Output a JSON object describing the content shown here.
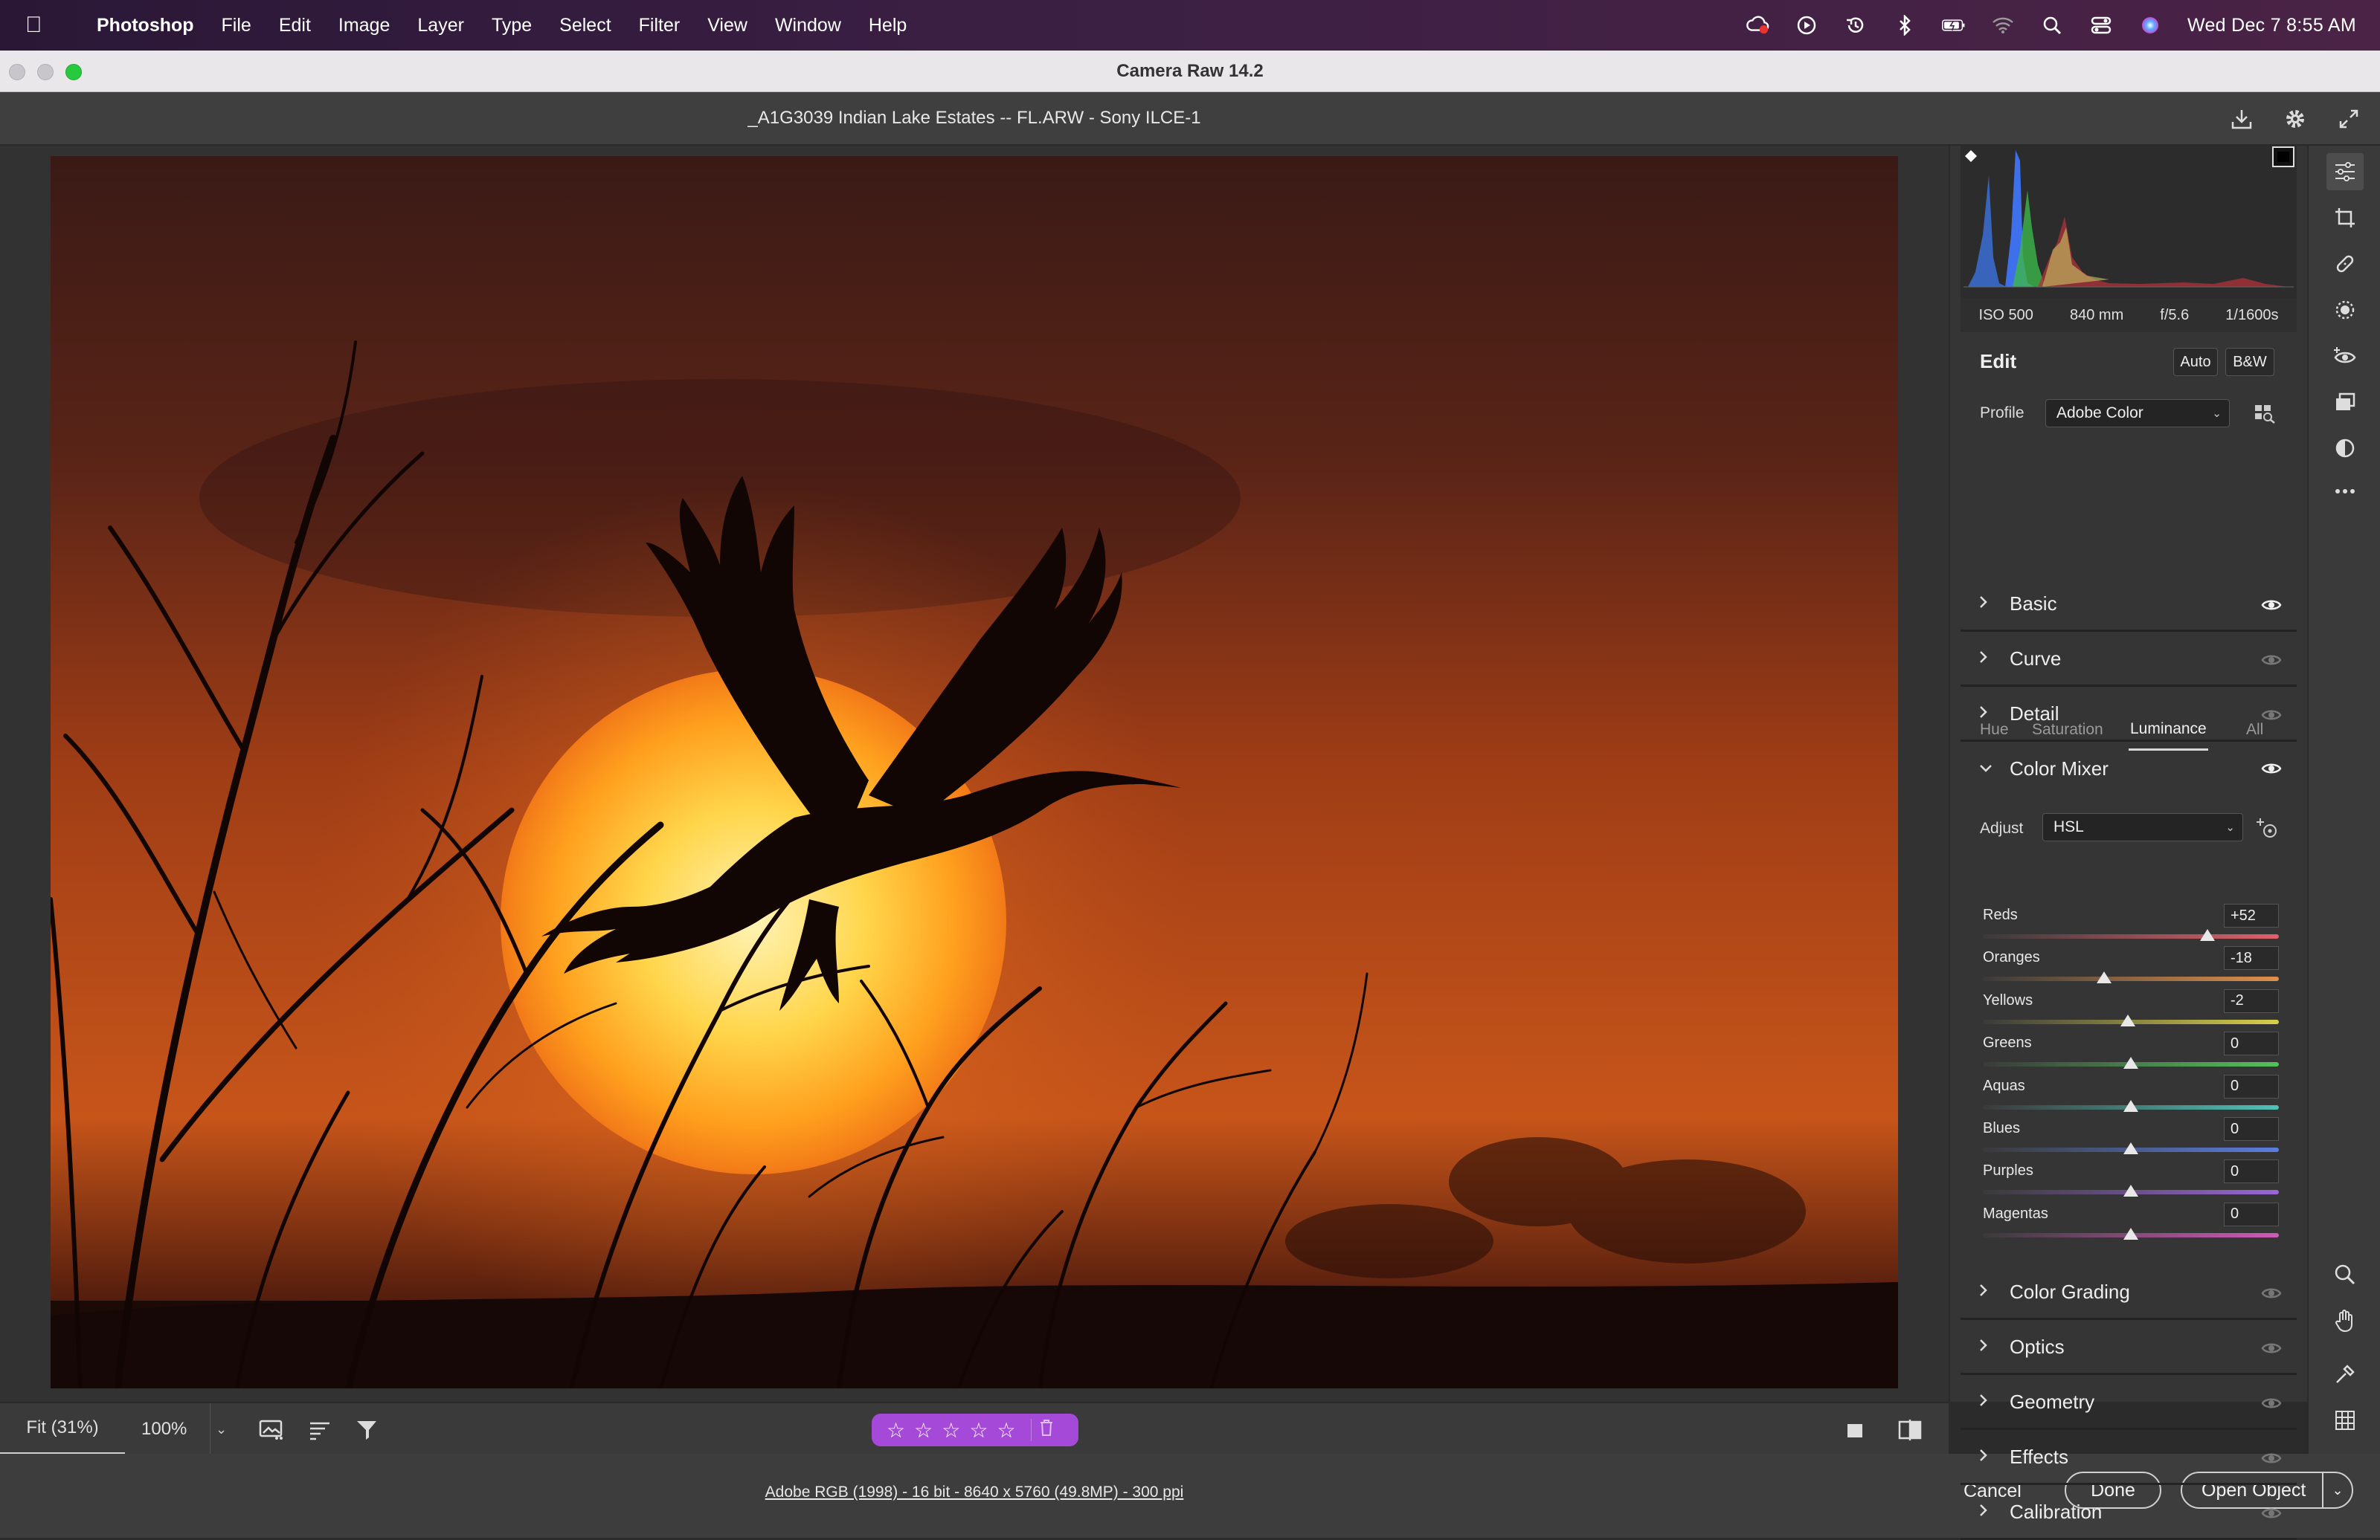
{
  "menubar": {
    "app": "Photoshop",
    "items": [
      "File",
      "Edit",
      "Image",
      "Layer",
      "Type",
      "Select",
      "Filter",
      "View",
      "Window",
      "Help"
    ],
    "clock": "Wed Dec 7  8:55 AM"
  },
  "window": {
    "title": "Camera Raw 14.2"
  },
  "toolbar": {
    "filename": "_A1G3039 Indian Lake Estates -- FL.ARW  -  Sony ILCE-1"
  },
  "histogram": {
    "exif": {
      "iso": "ISO 500",
      "focal": "840 mm",
      "aperture": "f/5.6",
      "shutter": "1/1600s"
    }
  },
  "edit": {
    "title": "Edit",
    "auto_label": "Auto",
    "bw_label": "B&W",
    "profile_label": "Profile",
    "profile_value": "Adobe Color"
  },
  "sections_top": [
    {
      "name": "Basic",
      "eye_active": true
    },
    {
      "name": "Curve",
      "eye_active": false
    },
    {
      "name": "Detail",
      "eye_active": false
    }
  ],
  "color_mixer": {
    "name": "Color Mixer",
    "adjust_label": "Adjust",
    "adjust_value": "HSL",
    "tabs": [
      "Hue",
      "Saturation",
      "Luminance",
      "All"
    ],
    "active_tab": "Luminance",
    "sliders": [
      {
        "name": "Reds",
        "value": "+52",
        "level": 52,
        "color": "#e0606a"
      },
      {
        "name": "Oranges",
        "value": "-18",
        "level": -18,
        "color": "#e0904a"
      },
      {
        "name": "Yellows",
        "value": "-2",
        "level": -2,
        "color": "#d8cf4a"
      },
      {
        "name": "Greens",
        "value": "0",
        "level": 0,
        "color": "#54c25a"
      },
      {
        "name": "Aquas",
        "value": "0",
        "level": 0,
        "color": "#4ec2b8"
      },
      {
        "name": "Blues",
        "value": "0",
        "level": 0,
        "color": "#5a7ee0"
      },
      {
        "name": "Purples",
        "value": "0",
        "level": 0,
        "color": "#9a66d8"
      },
      {
        "name": "Magentas",
        "value": "0",
        "level": 0,
        "color": "#d05ab8"
      }
    ]
  },
  "sections_bottom": [
    {
      "name": "Color Grading"
    },
    {
      "name": "Optics"
    },
    {
      "name": "Geometry"
    },
    {
      "name": "Effects"
    },
    {
      "name": "Calibration"
    }
  ],
  "status": {
    "fit_label": "Fit (31%)",
    "zoom_label": "100%",
    "rating_stars": 0,
    "rating_max": 5
  },
  "bottom": {
    "doc_info": "Adobe RGB (1998) - 16 bit - 8640 x 5760 (49.8MP) - 300 ppi",
    "cancel_label": "Cancel",
    "done_label": "Done",
    "open_label": "Open Object"
  },
  "colors": {
    "accent": "#a54ad8"
  }
}
